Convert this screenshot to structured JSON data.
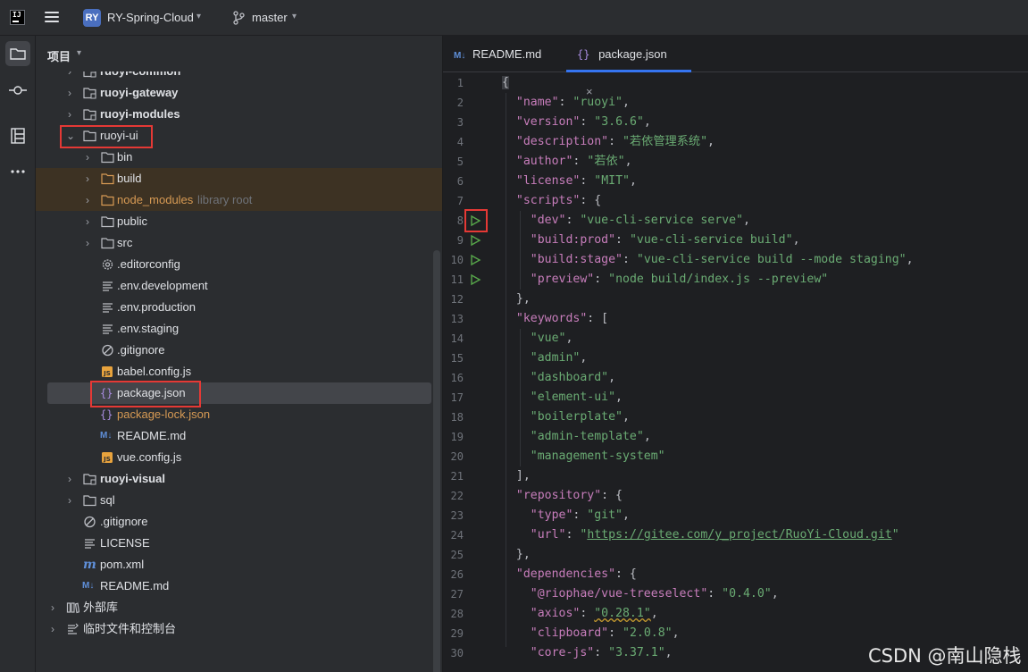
{
  "titlebar": {
    "project_badge": "RY",
    "project_name": "RY-Spring-Cloud",
    "branch": "master"
  },
  "panel": {
    "title": "项目"
  },
  "tree": {
    "rows": [
      {
        "label": "ruoyi-common"
      },
      {
        "label": "ruoyi-gateway"
      },
      {
        "label": "ruoyi-modules"
      },
      {
        "label": "ruoyi-ui"
      },
      {
        "label": "bin"
      },
      {
        "label": "build"
      },
      {
        "label": "node_modules",
        "suffix": "library root"
      },
      {
        "label": "public"
      },
      {
        "label": "src"
      },
      {
        "label": ".editorconfig"
      },
      {
        "label": ".env.development"
      },
      {
        "label": ".env.production"
      },
      {
        "label": ".env.staging"
      },
      {
        "label": ".gitignore"
      },
      {
        "label": "babel.config.js"
      },
      {
        "label": "package.json"
      },
      {
        "label": "package-lock.json"
      },
      {
        "label": "README.md"
      },
      {
        "label": "vue.config.js"
      },
      {
        "label": "ruoyi-visual"
      },
      {
        "label": "sql"
      },
      {
        "label": ".gitignore"
      },
      {
        "label": "LICENSE"
      },
      {
        "label": "pom.xml"
      },
      {
        "label": "README.md"
      },
      {
        "label": "外部库"
      },
      {
        "label": "临时文件和控制台"
      }
    ]
  },
  "editor": {
    "tabs": [
      {
        "label": "README.md",
        "icon_text": "M↓"
      },
      {
        "label": "package.json",
        "icon_text": "{}",
        "close": "×"
      }
    ],
    "line_numbers": [
      "1",
      "2",
      "3",
      "4",
      "5",
      "6",
      "7",
      "8",
      "9",
      "10",
      "11",
      "12",
      "13",
      "14",
      "15",
      "16",
      "17",
      "18",
      "19",
      "20",
      "21",
      "22",
      "23",
      "24",
      "25",
      "26",
      "27",
      "28",
      "29",
      "30"
    ],
    "code": {
      "l1": "{",
      "name_k": "\"name\"",
      "name_v": "\"ruoyi\"",
      "version_k": "\"version\"",
      "version_v": "\"3.6.6\"",
      "description_k": "\"description\"",
      "description_v": "\"若依管理系统\"",
      "author_k": "\"author\"",
      "author_v": "\"若依\"",
      "license_k": "\"license\"",
      "license_v": "\"MIT\"",
      "scripts_k": "\"scripts\"",
      "dev_k": "\"dev\"",
      "dev_v": "\"vue-cli-service serve\"",
      "buildprod_k": "\"build:prod\"",
      "buildprod_v": "\"vue-cli-service build\"",
      "buildstage_k": "\"build:stage\"",
      "buildstage_v": "\"vue-cli-service build --mode staging\"",
      "preview_k": "\"preview\"",
      "preview_v": "\"node build/index.js --preview\"",
      "keywords_k": "\"keywords\"",
      "kw1": "\"vue\"",
      "kw2": "\"admin\"",
      "kw3": "\"dashboard\"",
      "kw4": "\"element-ui\"",
      "kw5": "\"boilerplate\"",
      "kw6": "\"admin-template\"",
      "kw7": "\"management-system\"",
      "repository_k": "\"repository\"",
      "type_k": "\"type\"",
      "type_v": "\"git\"",
      "url_k": "\"url\"",
      "url_q1": "\"",
      "url_v": "https://gitee.com/y_project/RuoYi-Cloud.git",
      "url_q2": "\"",
      "dependencies_k": "\"dependencies\"",
      "treeselect_k": "\"@riophae/vue-treeselect\"",
      "treeselect_v": "\"0.4.0\"",
      "axios_k": "\"axios\"",
      "axios_v": "\"0.28.1\"",
      "clipboard_k": "\"clipboard\"",
      "clipboard_v": "\"2.0.8\"",
      "corejs_k": "\"core-js\"",
      "corejs_v": "\"3.37.1\""
    }
  },
  "watermark": "CSDN @南山隐栈",
  "colors": {
    "accent": "#3574f0",
    "highlight_box": "#e53935",
    "json_key": "#c77dbb",
    "json_string": "#6aab73",
    "excluded_folder": "#d79a54"
  }
}
